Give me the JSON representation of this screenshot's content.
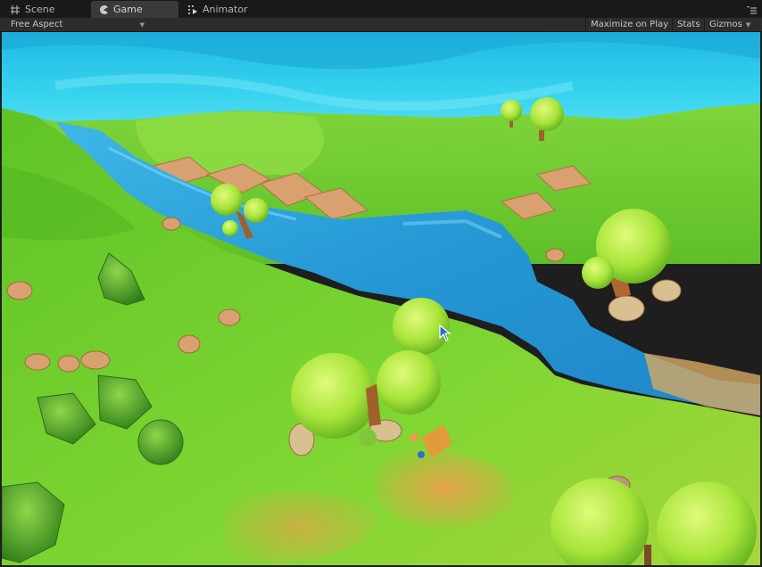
{
  "tabs": [
    {
      "label": "Scene",
      "icon": "scene-grid-icon",
      "active": false
    },
    {
      "label": "Game",
      "icon": "game-pacman-icon",
      "active": true
    },
    {
      "label": "Animator",
      "icon": "animator-icon",
      "active": false
    }
  ],
  "toolbar": {
    "aspect_label": "Free Aspect",
    "maximize_label": "Maximize on Play",
    "stats_label": "Stats",
    "gizmos_label": "Gizmos"
  },
  "colors": {
    "sky": "#23c3e6",
    "grass": "#6fcf2a",
    "river": "#2e9fd8",
    "rock": "#d9a070",
    "tree": "#9de33a"
  },
  "viewport": {
    "scene": "low-poly island with river, trees and rocks",
    "cursor_icon": "mouse-pointer-icon"
  }
}
